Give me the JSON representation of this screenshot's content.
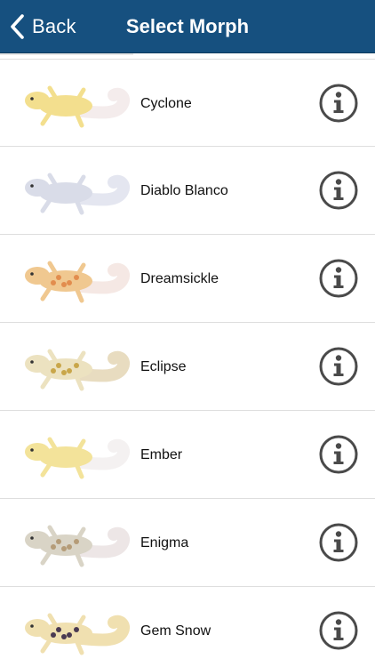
{
  "navbar": {
    "back_label": "Back",
    "title": "Select Morph",
    "background": "#16507f"
  },
  "morphs": [
    {
      "name": "Cyclone",
      "colors": {
        "body": "#f3df8e",
        "tail": "#f4ecec",
        "spots": "#f3df8e"
      }
    },
    {
      "name": "Diablo Blanco",
      "colors": {
        "body": "#d9dce8",
        "tail": "#e4e6f0",
        "spots": "#d9dce8"
      }
    },
    {
      "name": "Dreamsickle",
      "colors": {
        "body": "#f0c890",
        "tail": "#f5e8e4",
        "spots": "#e28d4e"
      }
    },
    {
      "name": "Eclipse",
      "colors": {
        "body": "#ece2c0",
        "tail": "#e8dcc0",
        "spots": "#c9a64a"
      }
    },
    {
      "name": "Ember",
      "colors": {
        "body": "#f3e39a",
        "tail": "#f4f1f1",
        "spots": "#f3e39a"
      }
    },
    {
      "name": "Enigma",
      "colors": {
        "body": "#d9d4c6",
        "tail": "#ede6e6",
        "spots": "#b59c78"
      }
    },
    {
      "name": "Gem Snow",
      "colors": {
        "body": "#f0e0b0",
        "tail": "#f0e0b0",
        "spots": "#4a3a52"
      }
    }
  ],
  "icons": {
    "back": "chevron-left-icon",
    "info": "info-circle-icon"
  }
}
